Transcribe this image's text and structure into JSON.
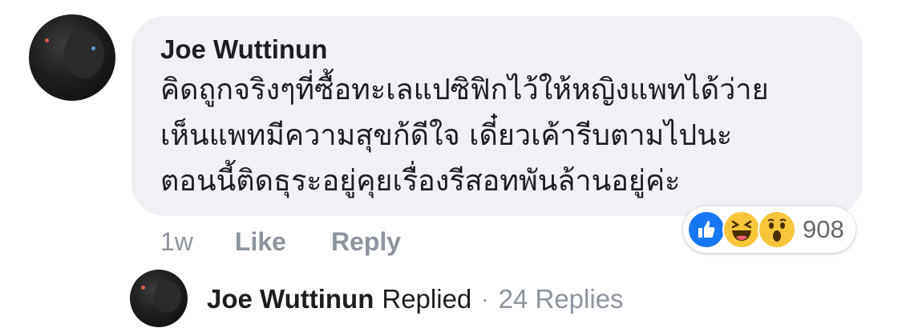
{
  "comment": {
    "author": "Joe Wuttinun",
    "lines": [
      "คิดถูกจริงๆที่ซื้อทะเลแปซิฟิกไว้ให้หญิงแพทได้ว่าย",
      "เห็นแพทมีความสุขก้ดีใจ เดี๋ยวเค้ารีบตามไปนะ",
      "ตอนนี้ติดธุระอยู่คุยเรื่องรีสอทพันล้านอยู่ค่ะ"
    ],
    "time": "1w",
    "like_label": "Like",
    "reply_label": "Reply",
    "reaction_count": "908",
    "reactions": [
      "like-reaction-icon",
      "haha-reaction-icon",
      "wow-reaction-icon"
    ]
  },
  "replies": {
    "author": "Joe Wuttinun",
    "replied_label": "Replied",
    "separator": "·",
    "count_label": "24 Replies"
  },
  "colors": {
    "bubble_bg": "#f0f1f5",
    "text": "#1c1e21",
    "muted": "#8d949e",
    "like_blue": "#1877f2",
    "emoji_yellow": "#f7c63a"
  }
}
